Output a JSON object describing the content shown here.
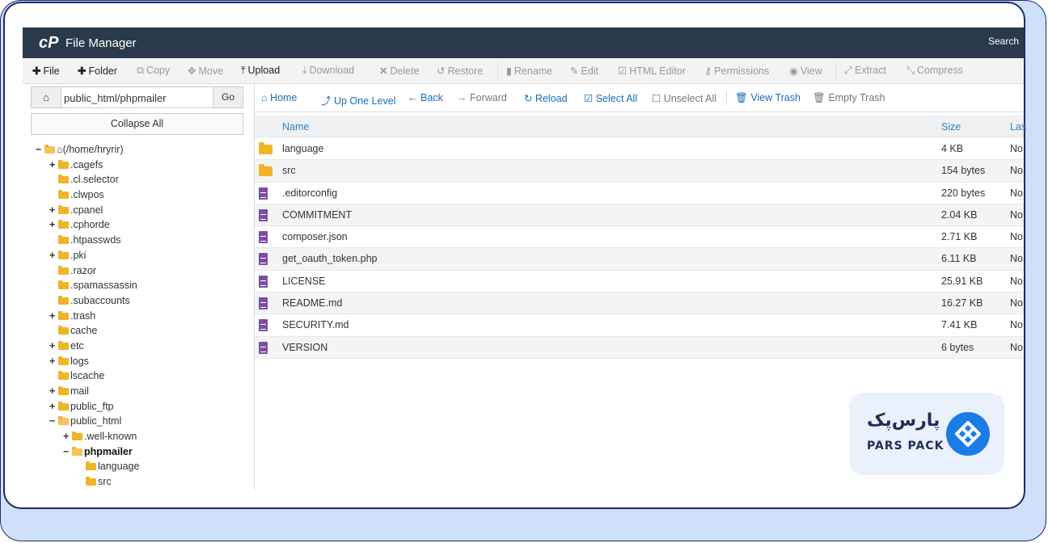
{
  "app": {
    "logo": "cP",
    "title": "File Manager",
    "search_label": "Search"
  },
  "toolbar": [
    {
      "label": "File",
      "icon": "plus-icon",
      "enabled": true
    },
    {
      "label": "Folder",
      "icon": "plus-icon",
      "enabled": true
    },
    {
      "label": "Copy",
      "icon": "copy-icon",
      "enabled": false
    },
    {
      "label": "Move",
      "icon": "move-icon",
      "enabled": false
    },
    {
      "label": "Upload",
      "icon": "upload-icon",
      "enabled": true
    },
    {
      "label": "Download",
      "icon": "download-icon",
      "enabled": false
    },
    {
      "label": "Delete",
      "icon": "delete-icon",
      "enabled": false
    },
    {
      "label": "Restore",
      "icon": "restore-icon",
      "enabled": false
    },
    {
      "label": "Rename",
      "icon": "rename-icon",
      "enabled": false
    },
    {
      "label": "Edit",
      "icon": "edit-icon",
      "enabled": false
    },
    {
      "label": "HTML Editor",
      "icon": "html-editor-icon",
      "enabled": false
    },
    {
      "label": "Permissions",
      "icon": "key-icon",
      "enabled": false
    },
    {
      "label": "View",
      "icon": "eye-icon",
      "enabled": false
    },
    {
      "label": "Extract",
      "icon": "extract-icon",
      "enabled": false
    },
    {
      "label": "Compress",
      "icon": "compress-icon",
      "enabled": false
    }
  ],
  "path": {
    "value": "public_html/phpmailer",
    "go_label": "Go",
    "collapse_label": "Collapse All"
  },
  "tree": [
    {
      "label": "(/home/hryrir)",
      "depth": 0,
      "toggle": "−",
      "open": true,
      "home": true
    },
    {
      "label": ".cagefs",
      "depth": 1,
      "toggle": "+"
    },
    {
      "label": ".cl.selector",
      "depth": 1,
      "toggle": ""
    },
    {
      "label": ".clwpos",
      "depth": 1,
      "toggle": ""
    },
    {
      "label": ".cpanel",
      "depth": 1,
      "toggle": "+"
    },
    {
      "label": ".cphorde",
      "depth": 1,
      "toggle": "+"
    },
    {
      "label": ".htpasswds",
      "depth": 1,
      "toggle": ""
    },
    {
      "label": ".pki",
      "depth": 1,
      "toggle": "+"
    },
    {
      "label": ".razor",
      "depth": 1,
      "toggle": ""
    },
    {
      "label": ".spamassassin",
      "depth": 1,
      "toggle": ""
    },
    {
      "label": ".subaccounts",
      "depth": 1,
      "toggle": ""
    },
    {
      "label": ".trash",
      "depth": 1,
      "toggle": "+"
    },
    {
      "label": "cache",
      "depth": 1,
      "toggle": ""
    },
    {
      "label": "etc",
      "depth": 1,
      "toggle": "+"
    },
    {
      "label": "logs",
      "depth": 1,
      "toggle": "+"
    },
    {
      "label": "lscache",
      "depth": 1,
      "toggle": ""
    },
    {
      "label": "mail",
      "depth": 1,
      "toggle": "+"
    },
    {
      "label": "public_ftp",
      "depth": 1,
      "toggle": "+"
    },
    {
      "label": "public_html",
      "depth": 1,
      "toggle": "−",
      "open": true
    },
    {
      "label": ".well-known",
      "depth": 2,
      "toggle": "+"
    },
    {
      "label": "phpmailer",
      "depth": 2,
      "toggle": "−",
      "open": true,
      "bold": true
    },
    {
      "label": "language",
      "depth": 3,
      "toggle": ""
    },
    {
      "label": "src",
      "depth": 3,
      "toggle": ""
    }
  ],
  "navbar": [
    {
      "label": "Home",
      "icon": "home-icon",
      "enabled": true
    },
    {
      "label": "Up One Level",
      "icon": "up-level-icon",
      "enabled": true
    },
    {
      "label": "Back",
      "icon": "back-arrow-icon",
      "enabled": true
    },
    {
      "label": "Forward",
      "icon": "forward-arrow-icon",
      "enabled": false
    },
    {
      "label": "Reload",
      "icon": "reload-icon",
      "enabled": true
    },
    {
      "label": "Select All",
      "icon": "checkbox-checked-icon",
      "enabled": true
    },
    {
      "label": "Unselect All",
      "icon": "checkbox-empty-icon",
      "enabled": false
    },
    {
      "label": "View Trash",
      "icon": "trash-icon",
      "enabled": true
    },
    {
      "label": "Empty Trash",
      "icon": "trash-icon",
      "enabled": false
    }
  ],
  "table": {
    "headers": {
      "name": "Name",
      "size": "Size",
      "last_modified": "Las"
    },
    "rows": [
      {
        "name": "language",
        "size": "4 KB",
        "modified": "No",
        "type": "folder"
      },
      {
        "name": "src",
        "size": "154 bytes",
        "modified": "No",
        "type": "folder"
      },
      {
        "name": ".editorconfig",
        "size": "220 bytes",
        "modified": "No",
        "type": "file"
      },
      {
        "name": "COMMITMENT",
        "size": "2.04 KB",
        "modified": "No",
        "type": "file"
      },
      {
        "name": "composer.json",
        "size": "2.71 KB",
        "modified": "No",
        "type": "file"
      },
      {
        "name": "get_oauth_token.php",
        "size": "6.11 KB",
        "modified": "No",
        "type": "file"
      },
      {
        "name": "LICENSE",
        "size": "25.91 KB",
        "modified": "No",
        "type": "file"
      },
      {
        "name": "README.md",
        "size": "16.27 KB",
        "modified": "No",
        "type": "file"
      },
      {
        "name": "SECURITY.md",
        "size": "7.41 KB",
        "modified": "No",
        "type": "file"
      },
      {
        "name": "VERSION",
        "size": "6 bytes",
        "modified": "No",
        "type": "file"
      }
    ]
  },
  "brand": {
    "name_fa": "پارس‌پک",
    "name_en": "PARS PACK",
    "color": "#1c7ce6"
  }
}
